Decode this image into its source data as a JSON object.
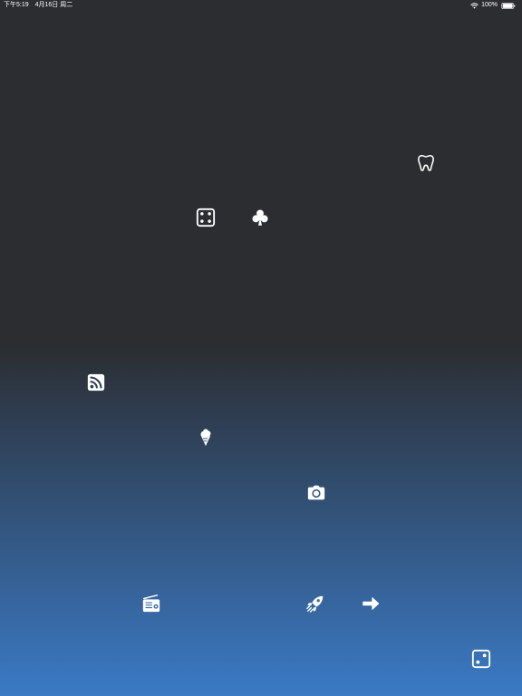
{
  "status_bar": {
    "time": "下午5:19",
    "date": "4月16日 周二",
    "battery": "100%"
  },
  "icons": [
    "tooth-icon",
    "dice-four-icon",
    "club-suit-icon",
    "rss-feed-icon",
    "ice-cream-icon",
    "camera-icon",
    "radio-icon",
    "rocket-icon",
    "arrow-right-icon",
    "dice-two-icon"
  ],
  "colors": {
    "background_top": "#2b2d30",
    "background_bottom": "#3a7ac5",
    "icon": "#ffffff"
  }
}
